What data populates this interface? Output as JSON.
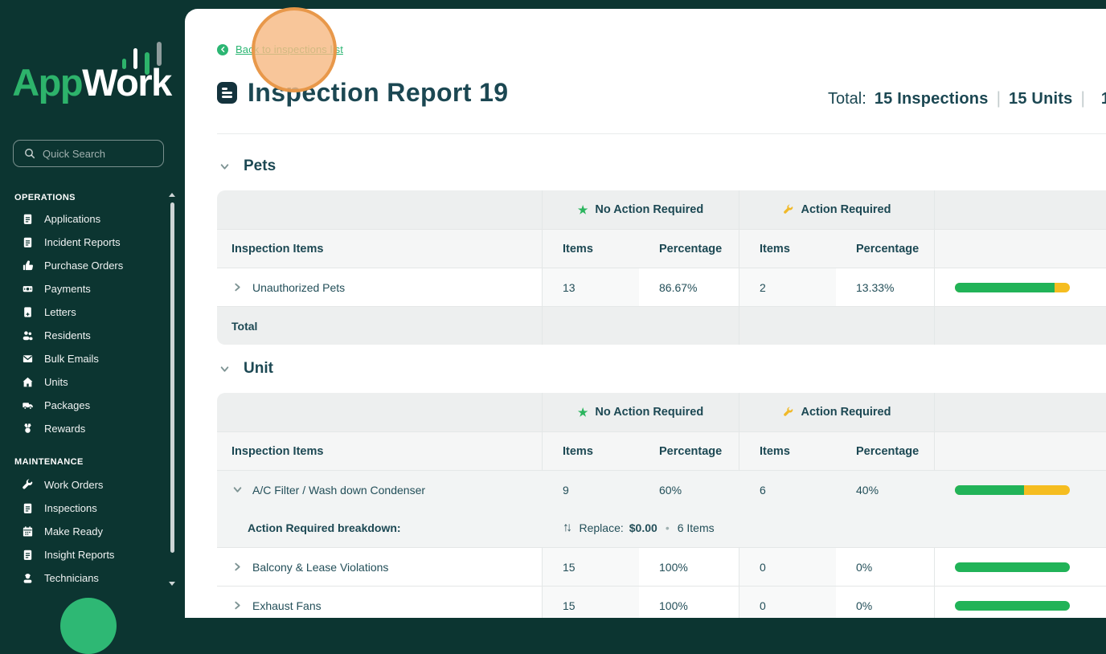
{
  "colors": {
    "accent_green": "#2cb673",
    "accent_yellow": "#f5bd20",
    "sidebar_bg": "#0c3531",
    "text_dark": "#1c4853"
  },
  "sidebar": {
    "logo_part1": "App",
    "logo_part2": "Work",
    "search_placeholder": "Quick Search",
    "groups": [
      {
        "label": "OPERATIONS",
        "items": [
          {
            "label": "Applications"
          },
          {
            "label": "Incident Reports"
          },
          {
            "label": "Purchase Orders"
          },
          {
            "label": "Payments"
          },
          {
            "label": "Letters"
          },
          {
            "label": "Residents"
          },
          {
            "label": "Bulk Emails"
          },
          {
            "label": "Units"
          },
          {
            "label": "Packages"
          },
          {
            "label": "Rewards"
          }
        ]
      },
      {
        "label": "MAINTENANCE",
        "items": [
          {
            "label": "Work Orders"
          },
          {
            "label": "Inspections"
          },
          {
            "label": "Make Ready"
          },
          {
            "label": "Insight Reports"
          },
          {
            "label": "Technicians"
          }
        ]
      }
    ]
  },
  "header": {
    "back_link_label": "Back to inspections list",
    "title": "Inspection Report 19",
    "total_label": "Total:",
    "total_items": [
      "15 Inspections",
      "15 Units",
      "1"
    ]
  },
  "tables": {
    "group_no_action": "No Action Required",
    "group_action": "Action Required",
    "col_inspection_items": "Inspection Items",
    "col_items": "Items",
    "col_percentage": "Percentage",
    "total_label": "Total"
  },
  "sections": [
    {
      "title": "Pets",
      "rows": [
        {
          "name": "Unauthorized Pets",
          "no_action_items": "13",
          "no_action_pct": "86.67%",
          "action_items": "2",
          "action_pct": "13.33%",
          "bar_green_pct": 86.67
        }
      ]
    },
    {
      "title": "Unit",
      "rows": [
        {
          "name": "A/C Filter / Wash down Condenser",
          "no_action_items": "9",
          "no_action_pct": "60%",
          "action_items": "6",
          "action_pct": "40%",
          "bar_green_pct": 60,
          "breakdown": {
            "label": "Action Required breakdown:",
            "action": "Replace:",
            "amount": "$0.00",
            "count": "6 Items"
          }
        },
        {
          "name": "Balcony & Lease Violations",
          "no_action_items": "15",
          "no_action_pct": "100%",
          "action_items": "0",
          "action_pct": "0%",
          "bar_green_pct": 100
        },
        {
          "name": "Exhaust Fans",
          "no_action_items": "15",
          "no_action_pct": "100%",
          "action_items": "0",
          "action_pct": "0%",
          "bar_green_pct": 100
        }
      ]
    }
  ]
}
